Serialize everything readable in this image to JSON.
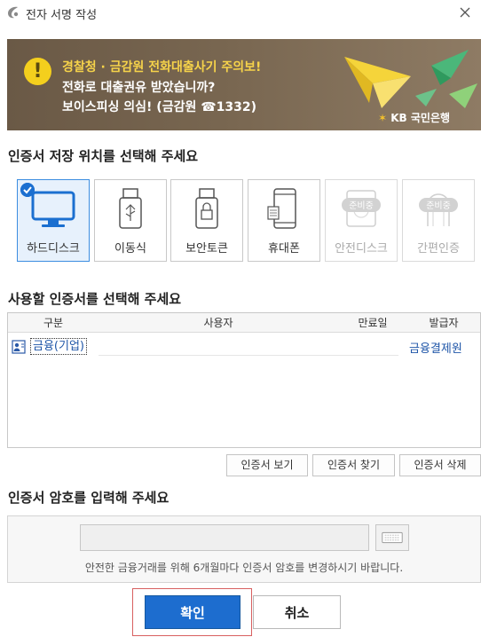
{
  "window": {
    "title": "전자 서명 작성"
  },
  "banner": {
    "line1": "경찰청 · 금감원 전화대출사기 주의보!",
    "line2": "전화로 대출권유 받았습니까?",
    "line3": "보이스피싱 의심! (금감원 ☎1332)",
    "bank_logo": "KB 국민은행",
    "colors": {
      "highlight": "#f6d34a",
      "background": "#6a5946"
    }
  },
  "location": {
    "title": "인증서 저장 위치를 선택해 주세요",
    "items": [
      {
        "label": "하드디스크",
        "icon": "monitor-icon",
        "selected": true
      },
      {
        "label": "이동식",
        "icon": "usb-icon"
      },
      {
        "label": "보안토큰",
        "icon": "security-token-icon"
      },
      {
        "label": "휴대폰",
        "icon": "phone-icon"
      },
      {
        "label": "안전디스크",
        "icon": "safe-disk-icon",
        "badge": "준비중",
        "disabled": true
      },
      {
        "label": "간편인증",
        "icon": "simple-auth-icon",
        "badge": "준비중",
        "disabled": true
      }
    ]
  },
  "certs": {
    "title": "사용할 인증서를 선택해 주세요",
    "columns": [
      "구분",
      "사용자",
      "만료일",
      "발급자"
    ],
    "rows": [
      {
        "type": "금융(기업)",
        "user": "",
        "expiry": "",
        "issuer": "금융결제원"
      }
    ],
    "buttons": {
      "view": "인증서 보기",
      "find": "인증서 찾기",
      "delete": "인증서 삭제"
    }
  },
  "password": {
    "title": "인증서 암호를 입력해 주세요",
    "value": "",
    "notice": "안전한 금융거래를 위해 6개월마다 인증서 암호를 변경하시기 바랍니다."
  },
  "actions": {
    "ok": "확인",
    "cancel": "취소"
  },
  "theme": {
    "accent": "#1d6dcf",
    "link": "#1f56a8",
    "selected_bg": "#e7f1fc"
  }
}
